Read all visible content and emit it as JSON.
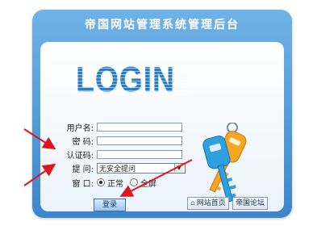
{
  "header": {
    "title": "帝国网站管理系统管理后台"
  },
  "logo": {
    "text": "LOGIN"
  },
  "form": {
    "username_label": "用户名:",
    "password_label": "密  码:",
    "captcha_label": "认证码:",
    "question_label": "提  问:",
    "question_value": "无安全提问",
    "window_label": "窗  口:",
    "window_options": [
      "正常",
      "全屏"
    ],
    "window_selected": "正常"
  },
  "buttons": {
    "login": "登录",
    "site_home": "网站首页",
    "forum": "帝国论坛"
  },
  "colors": {
    "panel_top": "#6fb2e6",
    "panel_bottom": "#3d86cc",
    "login_text": "#2a7cc9",
    "arrow": "#e0141e"
  }
}
